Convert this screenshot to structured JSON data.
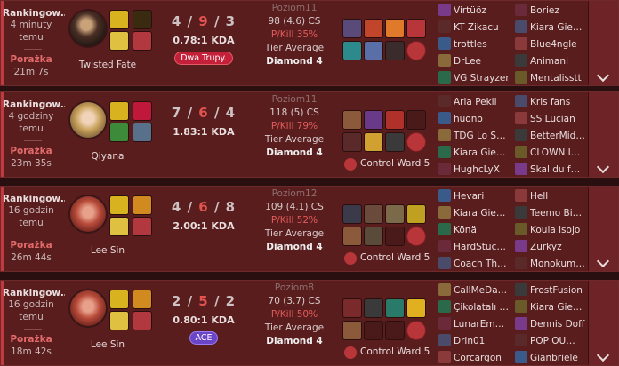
{
  "matches": [
    {
      "mode": "Rankingow…",
      "ago": "4 minuty temu",
      "result": "Porażka",
      "duration": "21m 7s",
      "champion": "Twisted Fate",
      "kills": "4",
      "deaths": "9",
      "assists": "3",
      "kda": "0.78:1 KDA",
      "badge": "Dwa Trupy.",
      "badge_color": "red",
      "level": "Poziom11",
      "cs": "98 (4.6) CS",
      "pkill": "P/Kill 35%",
      "tier_label": "Tier Average",
      "tier": "Diamond 4",
      "ward_label": "",
      "players_left": [
        "Virtüöz",
        "KT Zikacu",
        "trottles",
        "DrLee",
        "VG Strayzer"
      ],
      "players_right": [
        "Boriez",
        "Kiara Gie…",
        "Blue4ngle",
        "Animani",
        "Mentalisstt"
      ]
    },
    {
      "mode": "Rankingow…",
      "ago": "4 godziny temu",
      "result": "Porażka",
      "duration": "23m 35s",
      "champion": "Qiyana",
      "kills": "7",
      "deaths": "6",
      "assists": "4",
      "kda": "1.83:1 KDA",
      "badge": "",
      "badge_color": "",
      "level": "Poziom11",
      "cs": "118 (5) CS",
      "pkill": "P/Kill 79%",
      "tier_label": "Tier Average",
      "tier": "Diamond 4",
      "ward_label": "Control Ward 5",
      "players_left": [
        "Aria Pekil",
        "huono",
        "TDG Lo S…",
        "Kiara Gie…",
        "HughcLyX"
      ],
      "players_right": [
        "Kris fans",
        "SS Lucian",
        "BetterMid…",
        "CLOWN I…",
        "Skal du f…"
      ]
    },
    {
      "mode": "Rankingow…",
      "ago": "16 godzin temu",
      "result": "Porażka",
      "duration": "26m 44s",
      "champion": "Lee Sin",
      "kills": "4",
      "deaths": "6",
      "assists": "8",
      "kda": "2.00:1 KDA",
      "badge": "",
      "badge_color": "",
      "level": "Poziom12",
      "cs": "109 (4.1) CS",
      "pkill": "P/Kill 52%",
      "tier_label": "Tier Average",
      "tier": "Diamond 4",
      "ward_label": "Control Ward 5",
      "players_left": [
        "Hevari",
        "Kiara Gie…",
        "Könä",
        "HardStuc…",
        "Coach Th…"
      ],
      "players_right": [
        "Hell",
        "Teemo Bi…",
        "Koula isojo",
        "Zurkyz",
        "Monokum…"
      ]
    },
    {
      "mode": "Rankingow…",
      "ago": "16 godzin temu",
      "result": "Porażka",
      "duration": "18m 42s",
      "champion": "Lee Sin",
      "kills": "2",
      "deaths": "5",
      "assists": "2",
      "kda": "0.80:1 KDA",
      "badge": "ACE",
      "badge_color": "purple",
      "level": "Poziom8",
      "cs": "70 (3.7) CS",
      "pkill": "P/Kill 50%",
      "tier_label": "Tier Average",
      "tier": "Diamond 4",
      "ward_label": "Control Ward 5",
      "players_left": [
        "CallMeDa…",
        "Çikolatalı …",
        "LunarEm…",
        "Drin01",
        "Corcargon"
      ],
      "players_right": [
        "FrostFusion",
        "Kiara Gie…",
        "Dennis Doff",
        "POP OU…",
        "Gianbriele"
      ]
    }
  ],
  "colors": {
    "loss_accent": "#c23a3f",
    "card_bg": "#5a1d1e",
    "death_red": "#e3534f"
  }
}
